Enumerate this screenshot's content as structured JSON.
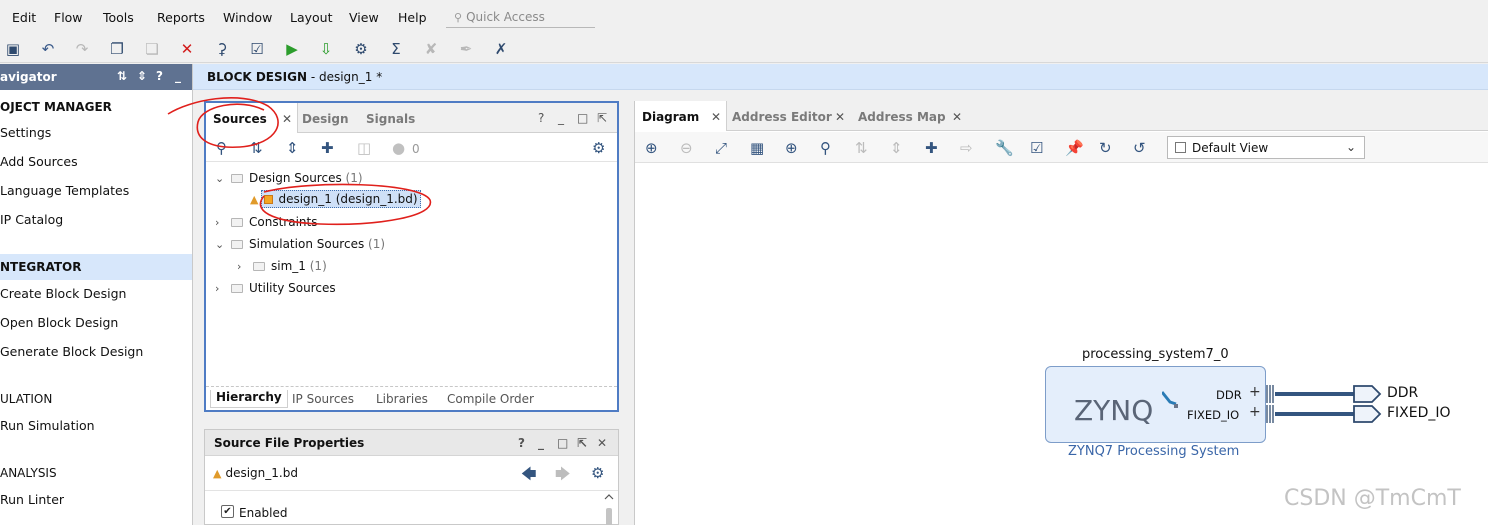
{
  "menu": {
    "items": [
      {
        "id": "edit",
        "label": "Edit"
      },
      {
        "id": "flow",
        "label": "Flow"
      },
      {
        "id": "tools",
        "label": "Tools"
      },
      {
        "id": "reports",
        "label": "Reports"
      },
      {
        "id": "window",
        "label": "Window"
      },
      {
        "id": "layout",
        "label": "Layout"
      },
      {
        "id": "view",
        "label": "View"
      },
      {
        "id": "help",
        "label": "Help"
      }
    ],
    "quick_access_placeholder": "Quick Access"
  },
  "header": {
    "title_bold": "BLOCK DESIGN",
    "title_rest": " - design_1 *"
  },
  "navigator": {
    "title": "avigator",
    "sections": [
      {
        "label": "OJECT MANAGER",
        "items": [
          "Settings",
          "Add Sources",
          "Language Templates",
          "IP Catalog"
        ]
      },
      {
        "label": "NTEGRATOR",
        "items": [
          "Create Block Design",
          "Open Block Design",
          "Generate Block Design"
        ]
      },
      {
        "label": "ULATION",
        "items": [
          "Run Simulation"
        ]
      },
      {
        "label": " ANALYSIS",
        "items": [
          "Run Linter"
        ]
      }
    ]
  },
  "sources": {
    "tabs": [
      "Sources",
      "Design",
      "Signals"
    ],
    "count_badge": "0",
    "tree": {
      "design_sources": {
        "label": "Design Sources",
        "count": "(1)"
      },
      "design_file": "design_1 (design_1.bd)",
      "constraints": {
        "label": "Constraints"
      },
      "simulation_sources": {
        "label": "Simulation Sources",
        "count": "(1)"
      },
      "sim_1": {
        "label": "sim_1",
        "count": "(1)"
      },
      "utility_sources": {
        "label": "Utility Sources"
      }
    },
    "bottom_tabs": [
      "Hierarchy",
      "IP Sources",
      "Libraries",
      "Compile Order"
    ]
  },
  "source_file_properties": {
    "title": "Source File Properties",
    "file": "design_1.bd",
    "enabled_label": "Enabled",
    "enabled": true
  },
  "diagram": {
    "tabs": [
      "Diagram",
      "Address Editor",
      "Address Map"
    ],
    "view_select": "Default View",
    "block": {
      "instance_name": "processing_system7_0",
      "logo_text": "ZYNQ",
      "subtitle": "ZYNQ7 Processing System",
      "ports": [
        "DDR",
        "FIXED_IO"
      ],
      "external_ports": [
        "DDR",
        "FIXED_IO"
      ]
    }
  },
  "watermark": "CSDN @TmCmT"
}
